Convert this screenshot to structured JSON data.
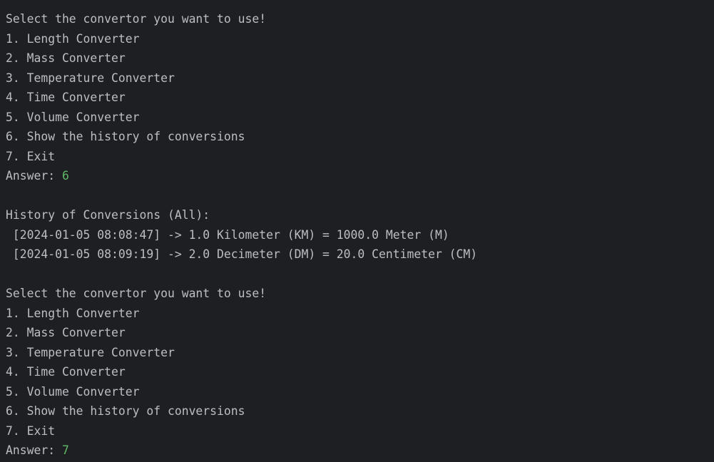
{
  "menu": {
    "prompt": "Select the convertor you want to use!",
    "options": [
      "1. Length Converter",
      "2. Mass Converter",
      "3. Temperature Converter",
      "4. Time Converter",
      "5. Volume Converter",
      "6. Show the history of conversions",
      "7. Exit"
    ],
    "answer_label": "Answer: "
  },
  "session": [
    {
      "answer": "6"
    },
    {
      "answer": "7"
    }
  ],
  "history": {
    "title": "History of Conversions (All):",
    "entries": [
      " [2024-01-05 08:08:47] -> 1.0 Kilometer (KM) = 1000.0 Meter (M)",
      " [2024-01-05 08:09:19] -> 2.0 Decimeter (DM) = 20.0 Centimeter (CM)"
    ]
  },
  "colors": {
    "background": "#1e1f22",
    "text": "#bcbec4",
    "user_input": "#5fb865"
  }
}
